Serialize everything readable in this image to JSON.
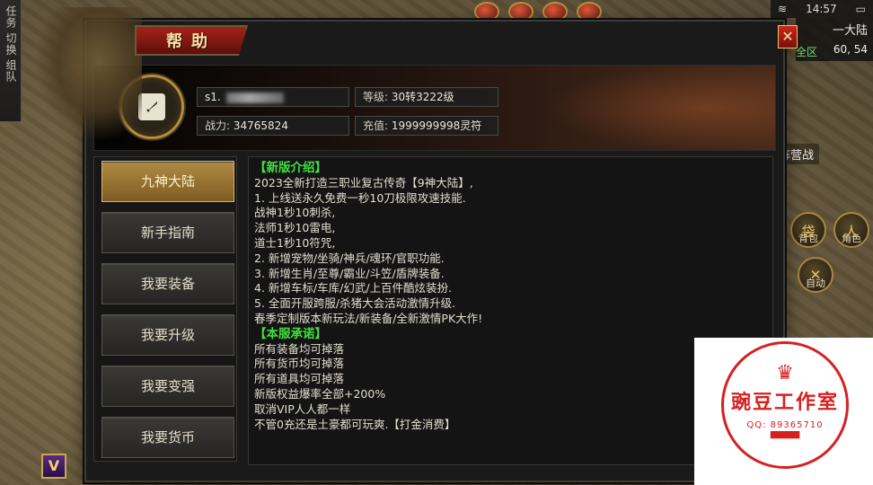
{
  "hud": {
    "time": "14:57",
    "map_name": "一大陆",
    "coords": "60, 54",
    "zone_label": "全区",
    "side_label": "阵营战",
    "side_tabs": [
      "任务",
      "切换",
      "组队"
    ],
    "skills": [
      {
        "label": "背包",
        "glyph": "袋"
      },
      {
        "label": "角色",
        "glyph": "人"
      },
      {
        "label": "自动",
        "glyph": "✕"
      }
    ],
    "dock_icon": "V",
    "colors": {
      "accent_gold": "#b58d3a",
      "title_red": "#a3231a",
      "heading_green": "#3fe03f",
      "active_gold": "#b08a45"
    }
  },
  "dialog": {
    "title": "帮助",
    "close_symbol": "✕",
    "header": {
      "name_prefix": "s1.",
      "level_label": "等级:",
      "level_value": "30转3222级",
      "power_label": "战力:",
      "power_value": "34765824",
      "recharge_label": "充值:",
      "recharge_value": "1999999998灵符"
    },
    "menu": [
      {
        "label": "九神大陆",
        "active": true
      },
      {
        "label": "新手指南",
        "active": false
      },
      {
        "label": "我要装备",
        "active": false
      },
      {
        "label": "我要升级",
        "active": false
      },
      {
        "label": "我要变强",
        "active": false
      },
      {
        "label": "我要货币",
        "active": false
      }
    ],
    "content": {
      "section1_title": "【新版介绍】",
      "section1_lines": [
        "2023全新打造三职业复古传奇【9神大陆】,",
        "1. 上线送永久免费一秒10刀极限攻速技能.",
        "战神1秒10刺杀,",
        "法师1秒10雷电,",
        "道士1秒10符咒,",
        "2. 新增宠物/坐骑/神兵/魂环/官职功能.",
        "3. 新增生肖/至尊/霸业/斗笠/盾牌装备.",
        "4. 新增车标/车库/幻武/上百件酷炫装扮.",
        "5. 全面开服跨服/杀猪大会活动激情升级.",
        "春季定制版本新玩法/新装备/全新激情PK大作!"
      ],
      "section2_title": "【本服承诺】",
      "section2_lines": [
        "所有装备均可掉落",
        "所有货币均可掉落",
        "所有道具均可掉落",
        "新版权益爆率全部+200%",
        "取消VIP人人都一样",
        "不管0充还是土豪都可玩爽.【打金消费】"
      ]
    }
  },
  "watermark": {
    "brand": "豌豆工作室",
    "qq": "QQ: 89365710",
    "crown": "♛",
    "base": "▀▀▀"
  }
}
